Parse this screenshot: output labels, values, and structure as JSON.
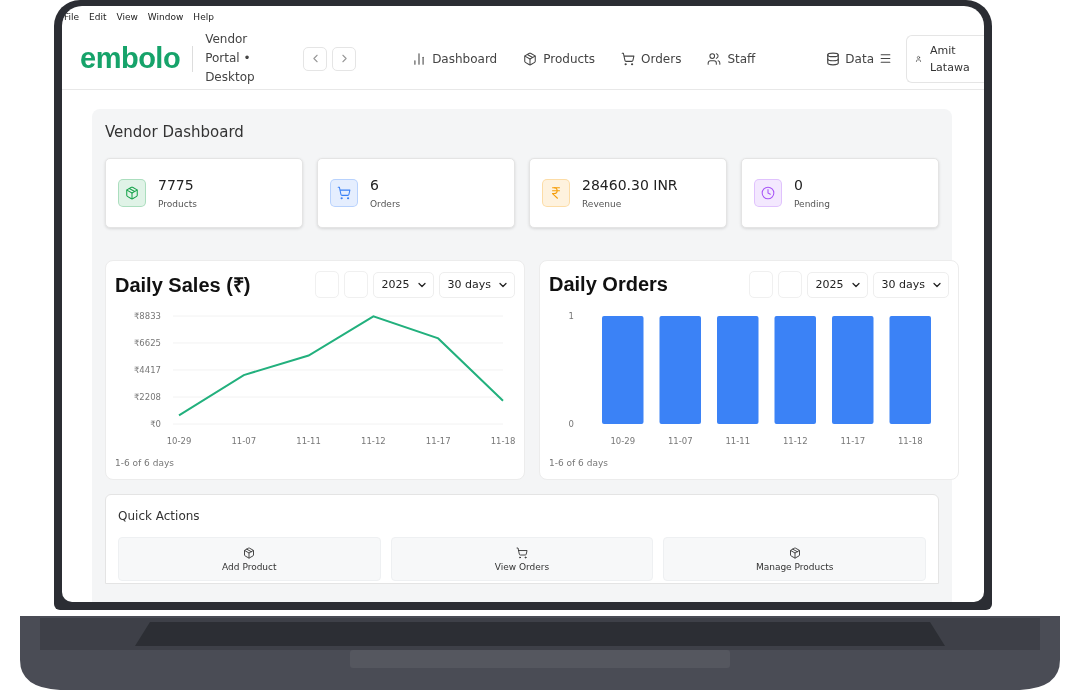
{
  "menu_bar": [
    "File",
    "Edit",
    "View",
    "Window",
    "Help"
  ],
  "header": {
    "logo": "embolo",
    "subtitle": "Vendor Portal • Desktop",
    "nav": [
      {
        "label": "Dashboard",
        "kind": "chart"
      },
      {
        "label": "Products",
        "kind": "package"
      },
      {
        "label": "Orders",
        "kind": "cart"
      },
      {
        "label": "Staff",
        "kind": "users"
      }
    ],
    "data_menu": "Data",
    "user": "Amit Latawa"
  },
  "page_title": "Vendor Dashboard",
  "stats": [
    {
      "value": "7775",
      "label": "Products",
      "kind": "package",
      "color": "#16a34a"
    },
    {
      "value": "6",
      "label": "Orders",
      "kind": "cart",
      "color": "#3b82f6"
    },
    {
      "value": "28460.30 INR",
      "label": "Revenue",
      "kind": "rupee",
      "color": "#f59e0b"
    },
    {
      "value": "0",
      "label": "Pending",
      "kind": "clock",
      "color": "#a855f7"
    }
  ],
  "charts": [
    {
      "title": "Daily Sales (₹)",
      "year": "2025",
      "range": "30 days",
      "footer": "1-6 of 6 days",
      "chart_data": {
        "type": "line",
        "categories": [
          "10-29",
          "11-07",
          "11-11",
          "11-12",
          "11-17",
          "11-18"
        ],
        "series": [
          {
            "color": "#22b07d",
            "values": [
              700,
              4000,
              5600,
              8800,
              7000,
              1900
            ]
          }
        ],
        "grid": true,
        "ylim": [
          0,
          8833
        ],
        "yticks": [
          {
            "value": 0,
            "label": "₹0"
          },
          {
            "value": 2208,
            "label": "₹2208"
          },
          {
            "value": 4417,
            "label": "₹4417"
          },
          {
            "value": 6625,
            "label": "₹6625"
          },
          {
            "value": 8833,
            "label": "₹8833"
          }
        ]
      }
    },
    {
      "title": "Daily Orders",
      "year": "2025",
      "range": "30 days",
      "footer": "1-6 of 6 days",
      "chart_data": {
        "type": "bar",
        "categories": [
          "10-29",
          "11-07",
          "11-11",
          "11-12",
          "11-17",
          "11-18"
        ],
        "series": [
          {
            "color": "#3b82f6",
            "values": [
              1,
              1,
              1,
              1,
              1,
              1
            ]
          }
        ],
        "ylim": [
          0,
          1
        ],
        "yticks": [
          0,
          1
        ]
      }
    }
  ],
  "quick_actions": {
    "title": "Quick Actions",
    "items": [
      {
        "label": "Add Product",
        "kind": "package"
      },
      {
        "label": "View Orders",
        "kind": "cart"
      },
      {
        "label": "Manage Products",
        "kind": "package"
      }
    ]
  }
}
